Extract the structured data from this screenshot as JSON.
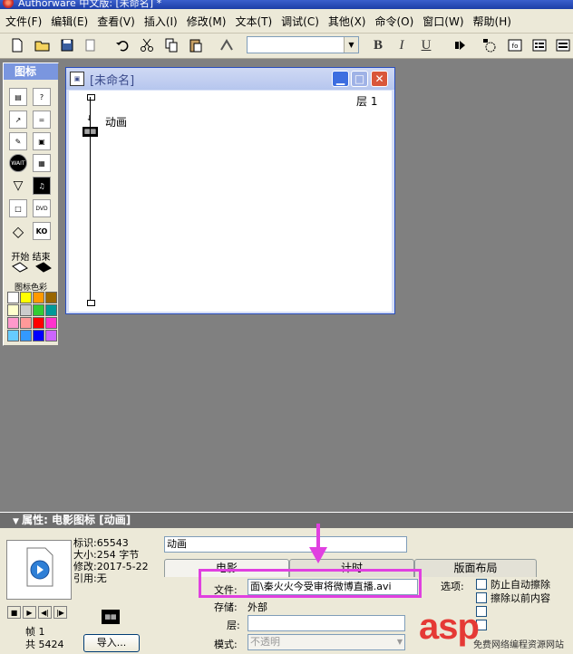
{
  "app": {
    "title": "Authorware 中文版: [未命名] *"
  },
  "menu": [
    "文件(F)",
    "编辑(E)",
    "查看(V)",
    "插入(I)",
    "修改(M)",
    "文本(T)",
    "调试(C)",
    "其他(X)",
    "命令(O)",
    "窗口(W)",
    "帮助(H)"
  ],
  "toolbar": {
    "font_combo": "",
    "bold": "B",
    "italic": "I",
    "underline": "U",
    "icons": [
      "new-file-icon",
      "open-folder-icon",
      "save-all-icon",
      "import-icon",
      "undo-icon",
      "cut-icon",
      "copy-icon",
      "paste-icon",
      "find-icon"
    ],
    "right_icons": [
      "run-icon",
      "control-panel-icon",
      "functions-icon",
      "variables-icon",
      "knowledge-objects-icon"
    ]
  },
  "palette": {
    "title": "图标",
    "icons": [
      "display-icon",
      "interaction-icon",
      "motion-icon",
      "calculation-icon",
      "erase-icon",
      "map-icon",
      "wait-icon",
      "digital-movie-icon",
      "navigate-icon",
      "sound-icon",
      "framework-icon",
      "dvd-icon",
      "decision-icon",
      "knowledge-object-icon"
    ],
    "start_label": "开始",
    "end_label": "结束",
    "colors_label": "图标色彩",
    "swatches": [
      "#ffffff",
      "#ffff00",
      "#ff9900",
      "#996600",
      "#ffffcc",
      "#cccccc",
      "#33cc33",
      "#009999",
      "#ff99cc",
      "#ff9999",
      "#ff0000",
      "#ff33cc",
      "#66ccff",
      "#3399ff",
      "#0000ff",
      "#cc66ff"
    ]
  },
  "design_window": {
    "title": "[未命名]",
    "layer_label": "层 1",
    "icon_label": "动画"
  },
  "properties": {
    "title": "属性: 电影图标 [动画]",
    "info": {
      "id": "标识:65543",
      "size": "大小:254 字节",
      "modified": "修改:2017-5-22",
      "ref": "引用:无"
    },
    "frame_label": "帧 1",
    "total_label": "共 5424",
    "import_button": "导入...",
    "name_value": "动画",
    "tabs": [
      "电影",
      "计时",
      "版面布局"
    ],
    "file_label": "文件:",
    "file_value": "面\\秦火火今受审将微博直播.avi",
    "storage_label": "存储:",
    "storage_value": "外部",
    "layer_label": "层:",
    "layer_value": "",
    "mode_label": "模式:",
    "mode_value": "不透明",
    "options_label": "选项:",
    "options": [
      {
        "label": "防止自动擦除",
        "checked": false
      },
      {
        "label": "擦除以前内容",
        "checked": false
      },
      {
        "label": "",
        "checked": false
      },
      {
        "label": "",
        "checked": false
      }
    ]
  },
  "watermark": {
    "text": "asp",
    "sub": "免费网络编程资源网站"
  }
}
